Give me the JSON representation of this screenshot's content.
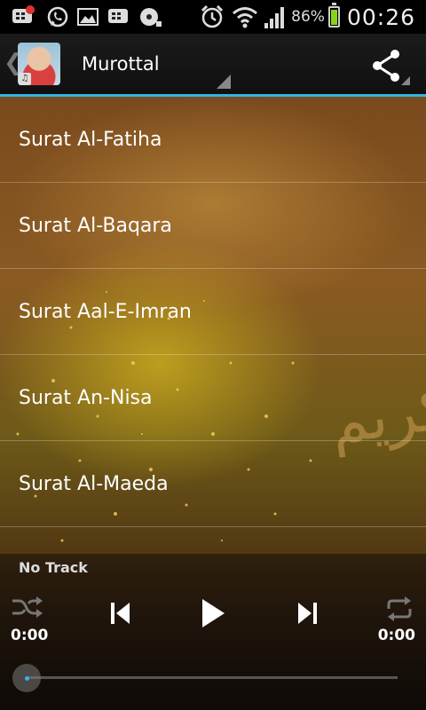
{
  "status_bar": {
    "battery_percent": "86%",
    "battery_level": 0.86,
    "time": "00:26",
    "left_icons": [
      "bbm-notification-icon",
      "whatsapp-icon",
      "gallery-icon",
      "bbm-icon",
      "media-icon"
    ],
    "right_icons": [
      "alarm-icon",
      "wifi-icon",
      "signal-icon",
      "battery-icon"
    ]
  },
  "action_bar": {
    "title": "Murottal",
    "icons": [
      "back-chevron-icon",
      "app-avatar",
      "share-icon"
    ]
  },
  "list": {
    "items": [
      {
        "label": "Surat Al-Fatiha"
      },
      {
        "label": "Surat Al-Baqara"
      },
      {
        "label": "Surat Aal-E-Imran"
      },
      {
        "label": "Surat An-Nisa"
      },
      {
        "label": "Surat Al-Maeda"
      }
    ]
  },
  "player": {
    "track": "No Track",
    "elapsed": "0:00",
    "duration": "0:00",
    "progress": 0,
    "controls": [
      "shuffle-icon",
      "previous-icon",
      "play-icon",
      "next-icon",
      "repeat-icon"
    ]
  },
  "colors": {
    "accent": "#33b5e5",
    "battery": "#8ad31a"
  }
}
